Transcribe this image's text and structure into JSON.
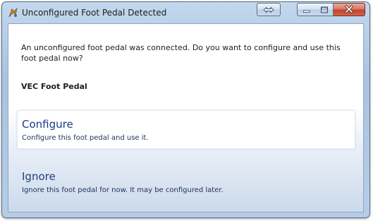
{
  "window": {
    "title": "Unconfigured Foot Pedal Detected",
    "app_icon": "foot-pedal-app-icon",
    "controls": [
      "restore-icon",
      "minimize-icon",
      "maximize-icon",
      "close-icon"
    ]
  },
  "message": "An unconfigured foot pedal was connected. Do you want to configure and use this foot pedal now?",
  "device_name": "VEC Foot Pedal",
  "options": [
    {
      "title": "Configure",
      "description": "Configure this foot pedal and use it."
    },
    {
      "title": "Ignore",
      "description": "Ignore this foot pedal for now. It may be configured later."
    }
  ],
  "colors": {
    "accent": "#1b3a8c",
    "close_button": "#c4432b",
    "frame": "#a9c3e0"
  }
}
